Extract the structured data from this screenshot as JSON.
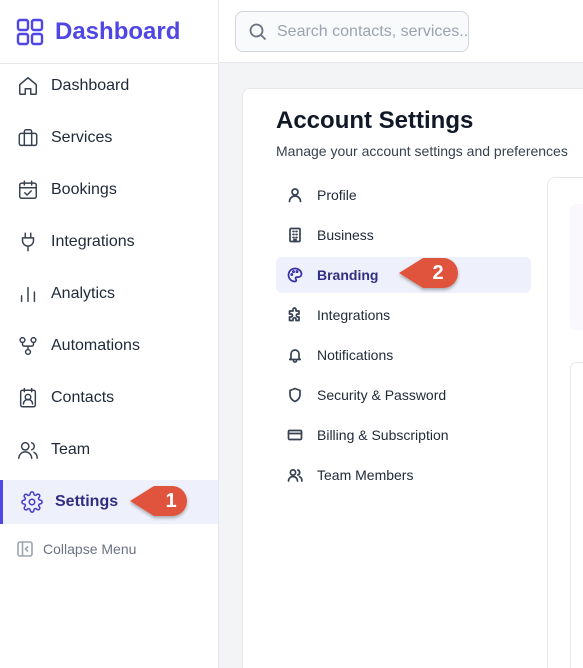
{
  "app": {
    "title": "Dashboard",
    "accent": "#4f46e5"
  },
  "search": {
    "placeholder": "Search contacts, services...",
    "icon": "search-icon"
  },
  "sidebar": {
    "items": [
      {
        "label": "Dashboard",
        "icon": "home-icon"
      },
      {
        "label": "Services",
        "icon": "briefcase-icon"
      },
      {
        "label": "Bookings",
        "icon": "calendar-check-icon"
      },
      {
        "label": "Integrations",
        "icon": "plug-icon"
      },
      {
        "label": "Analytics",
        "icon": "bar-chart-icon"
      },
      {
        "label": "Automations",
        "icon": "workflow-icon"
      },
      {
        "label": "Contacts",
        "icon": "contact-book-icon"
      },
      {
        "label": "Team",
        "icon": "users-icon"
      },
      {
        "label": "Settings",
        "icon": "gear-icon",
        "active": true
      }
    ],
    "collapse_label": "Collapse Menu"
  },
  "main": {
    "title": "Account Settings",
    "subtitle": "Manage your account settings and preferences",
    "menu": [
      {
        "label": "Profile",
        "icon": "user-icon"
      },
      {
        "label": "Business",
        "icon": "building-icon"
      },
      {
        "label": "Branding",
        "icon": "palette-icon",
        "active": true
      },
      {
        "label": "Integrations",
        "icon": "puzzle-icon"
      },
      {
        "label": "Notifications",
        "icon": "bell-icon"
      },
      {
        "label": "Security & Password",
        "icon": "shield-icon"
      },
      {
        "label": "Billing & Subscription",
        "icon": "credit-card-icon"
      },
      {
        "label": "Team Members",
        "icon": "users-icon"
      }
    ]
  },
  "callouts": [
    {
      "number": "1",
      "color": "#e0533d"
    },
    {
      "number": "2",
      "color": "#e0533d"
    }
  ]
}
